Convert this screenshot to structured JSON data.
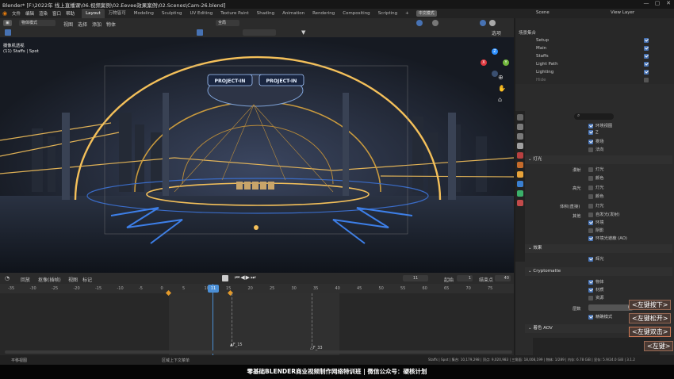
{
  "titlebar": {
    "title": "Blender* [F:\\2022年 线上直播课\\06.视频案例\\02.Eevee效果案例\\02.Scenes\\Cam-26.blend]",
    "minimize": "—",
    "maximize": "▢",
    "close": "✕"
  },
  "menubar": {
    "items": [
      "文件",
      "编辑",
      "渲染",
      "窗口",
      "帮助"
    ],
    "workspaces": [
      "Layout",
      "万物皆可",
      "Modeling",
      "Sculpting",
      "UV Editing",
      "Texture Paint",
      "Shading",
      "Animation",
      "Rendering",
      "Compositing",
      "Scripting"
    ],
    "add_tab": "+",
    "lang_button": "中文模式",
    "scene_label": "Scene",
    "view_layer_label": "View Layer"
  },
  "viewport_header": {
    "mode": "物体模式",
    "menus": [
      "视图",
      "选择",
      "添加",
      "物体"
    ],
    "transform": "全局",
    "options": "选项"
  },
  "viewport": {
    "camera_title": "摄像机透视",
    "camera_subtitle": "(11) Staffs | Spot",
    "sign_left": "PROJECT-IN",
    "sign_right": "PROJECT-IN",
    "gizmo_x": "X",
    "gizmo_y": "Y",
    "gizmo_z": "Z"
  },
  "outliner": {
    "title": "场景集合",
    "rows": [
      "Setup",
      "Main",
      "Staffs",
      "Light Path",
      "Lighting",
      "Hide"
    ]
  },
  "properties": {
    "search_placeholder": "",
    "rows_top": [
      "环境视图",
      "Z",
      "雾场",
      "法向"
    ],
    "sec_light": "灯光",
    "light_rows": [
      {
        "label": "漫射",
        "items": [
          "灯光",
          "颜色"
        ]
      },
      {
        "label": "高光",
        "items": [
          "灯光",
          "颜色"
        ]
      },
      {
        "label": "体积(直接)",
        "items": [
          "灯光"
        ]
      },
      {
        "label": "其他",
        "items": [
          "自发光(发射)",
          "环境",
          "阴影",
          "环境光遮蔽 (AO)"
        ]
      }
    ],
    "sec_effects": "效果",
    "effects_rows": [
      "辉光"
    ],
    "sec_crypto": "Cryptomatte",
    "crypto_rows": [
      "物体",
      "材质",
      "资源"
    ],
    "levels_label": "层数",
    "levels_value": "6",
    "accurate_mode": "精确模式",
    "sec_shader_aov": "着色 AOV"
  },
  "timeline": {
    "menus": [
      "回放",
      "抠像(插帧)",
      "视图",
      "标记"
    ],
    "current_frame": "11",
    "start_label": "起始",
    "start_value": "1",
    "end_label": "结束点",
    "end_value": "40",
    "ruler_ticks": [
      "-35",
      "-30",
      "-25",
      "-20",
      "-15",
      "-10",
      "-5",
      "0",
      "5",
      "10",
      "15",
      "20",
      "25",
      "30",
      "35",
      "40",
      "45",
      "50",
      "55",
      "60",
      "65",
      "70",
      "75"
    ],
    "markers": [
      "F_15",
      "F_33"
    ]
  },
  "statusbar": {
    "left_hint": "平移视图",
    "mid_hint": "区域上下文菜单",
    "stats": "Staffs | Spot | 集合: 10,179,298 | 顶点: 9,020,983 | 三角面: 18,008,199 | 物体: 1/289 | 内存: 6.78 GiB | 显存: 5.9/24.0 GiB | 3.1.2"
  },
  "key_badges": [
    "<左键按下>",
    "<左键松开>",
    "<左键双击>",
    "<左键>"
  ],
  "banner": {
    "text": "零基础BLENDER商业视频制作网络特训班 | 微信公众号：硬核计划"
  },
  "colors": {
    "accent": "#4772b3",
    "playhead": "#4b8fd6",
    "key_orange": "#e39a2b",
    "light_gold": "#f4c05a"
  }
}
